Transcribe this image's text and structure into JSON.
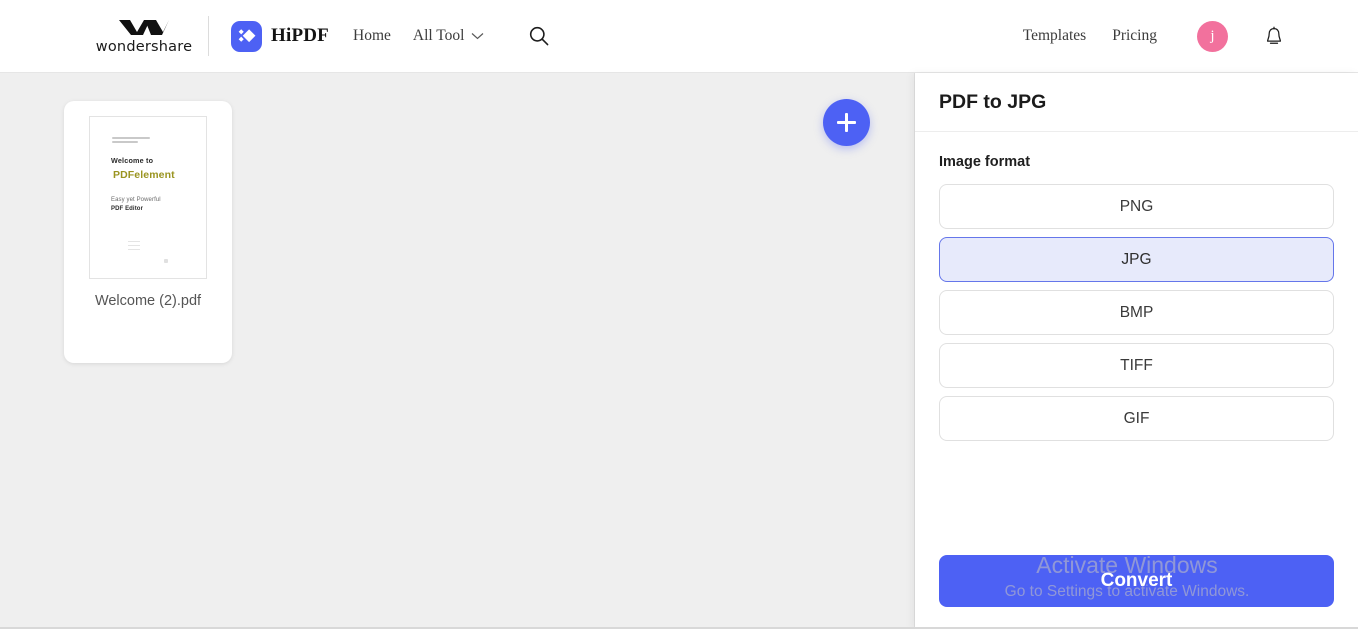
{
  "header": {
    "brand_wondershare": "wondershare",
    "brand_hipdf": "HiPDF",
    "nav": [
      {
        "label": "Home",
        "name": "nav-home"
      },
      {
        "label": "All Tool",
        "name": "nav-all-tool"
      }
    ],
    "right_nav": [
      {
        "label": "Templates",
        "name": "nav-templates"
      },
      {
        "label": "Pricing",
        "name": "nav-pricing"
      }
    ],
    "avatar_initial": "j",
    "icons": {
      "search": "search-icon",
      "chevron": "chevron-down-icon",
      "bell": "notification-bell-icon"
    }
  },
  "workspace": {
    "file": {
      "name": "Welcome (2).pdf",
      "thumbnail": {
        "welcome_line": "Welcome to",
        "title": "PDFelement",
        "subtitle_top": "Easy yet Powerful",
        "subtitle_bottom": "PDF Editor"
      }
    },
    "add_button_label": "+"
  },
  "panel": {
    "title": "PDF to JPG",
    "section_label": "Image format",
    "formats": [
      {
        "label": "PNG",
        "selected": false
      },
      {
        "label": "JPG",
        "selected": true
      },
      {
        "label": "BMP",
        "selected": false
      },
      {
        "label": "TIFF",
        "selected": false
      },
      {
        "label": "GIF",
        "selected": false
      }
    ],
    "convert_label": "Convert"
  },
  "watermark": {
    "line1": "Activate Windows",
    "line2": "Go to Settings to activate Windows."
  },
  "colors": {
    "accent_blue": "#4d61f4",
    "selected_bg": "#e7eafb",
    "selected_border": "#6576ea",
    "avatar_pink": "#f2719d",
    "workspace_bg": "#efefef",
    "pdf_title_olive": "#9a9420"
  }
}
